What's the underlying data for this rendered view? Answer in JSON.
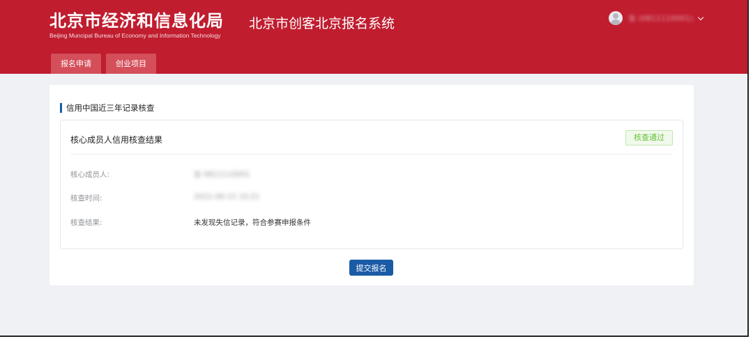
{
  "header": {
    "org_name_cn": "北京市经济和信息化局",
    "org_name_en": "Beijing Muncipal Bureau of Economy and Information Technology",
    "system_title": "北京市创客北京报名系统",
    "user_display": "张 (0811110001)"
  },
  "nav": {
    "tabs": [
      {
        "label": "报名申请"
      },
      {
        "label": "创业项目"
      }
    ]
  },
  "main": {
    "section_title": "信用中国近三年记录核查",
    "result_panel": {
      "title": "核心成员人信用核查结果",
      "status_badge": "核查通过",
      "rows": [
        {
          "label": "核心成员人:",
          "value": "张 0811110001"
        },
        {
          "label": "核查时间:",
          "value": "2021-06-15 10:21"
        },
        {
          "label": "核查结果:",
          "value": "未发现失信记录，符合参赛申报条件"
        }
      ]
    },
    "submit_label": "提交报名"
  },
  "colors": {
    "header_red": "#c01d2f",
    "nav_tab": "#d54f5a",
    "primary_blue": "#1a5ba6",
    "success_green": "#67c23a"
  }
}
